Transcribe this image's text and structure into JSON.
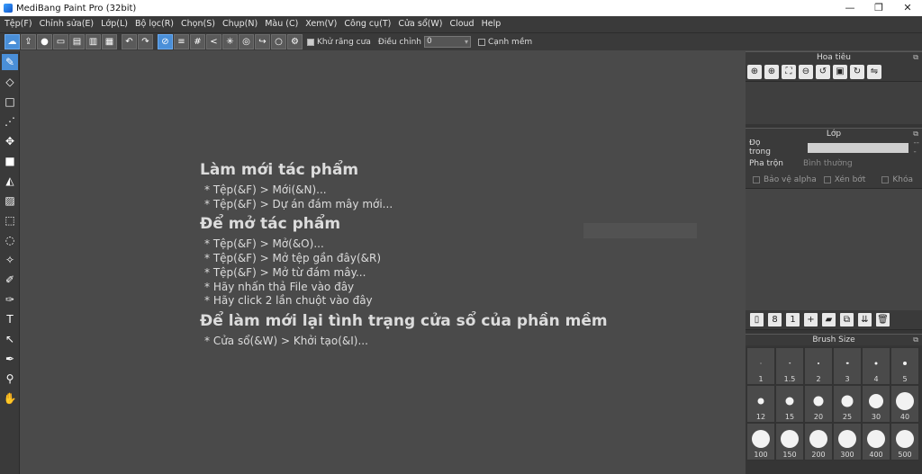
{
  "window": {
    "title": "MediBang Paint Pro (32bit)",
    "minimize": "—",
    "restore": "❐",
    "close": "✕"
  },
  "menu": [
    "Tệp(F)",
    "Chỉnh sửa(E)",
    "Lớp(L)",
    "Bộ lọc(R)",
    "Chọn(S)",
    "Chụp(N)",
    "Màu (C)",
    "Xem(V)",
    "Công cụ(T)",
    "Cửa sổ(W)",
    "Cloud",
    "Help"
  ],
  "toolbar": {
    "antialias_label": "Khử răng cưa",
    "adjust_label": "Điều chỉnh",
    "adjust_value": "0",
    "edge_label": "Cạnh mềm"
  },
  "welcome": {
    "new_heading": "Làm mới tác phẩm",
    "new_items": [
      "* Tệp(&F) > Mới(&N)...",
      "* Tệp(&F) > Dự án đám mây mới..."
    ],
    "open_heading": "Để mở tác phẩm",
    "open_items": [
      "* Tệp(&F) > Mở(&O)...",
      "* Tệp(&F) > Mở tệp gần đây(&R)",
      "* Tệp(&F) > Mở từ đám mây...",
      "* Hãy nhấn thả File vào đây",
      "* Hãy click 2 lần chuột vào đây"
    ],
    "reset_heading": "Để làm mới lại tình trạng cửa sổ của phần mềm",
    "reset_items": [
      "* Cửa sổ(&W) > Khởi tạo(&I)..."
    ]
  },
  "navigator": {
    "title": "Hoa tiêu"
  },
  "layer": {
    "title": "Lớp",
    "opacity_label": "Độ trong",
    "opacity_suffix": "---",
    "blend_label": "Pha trộn",
    "blend_value": "Bình thường",
    "lock_alpha": "Bảo vệ alpha",
    "clip": "Xén bớt",
    "lock": "Khóa"
  },
  "brush_size": {
    "title": "Brush Size",
    "sizes": [
      "1",
      "1.5",
      "2",
      "3",
      "4",
      "5",
      "12",
      "15",
      "20",
      "25",
      "30",
      "40",
      "100",
      "150",
      "200",
      "300",
      "400",
      "500"
    ]
  }
}
